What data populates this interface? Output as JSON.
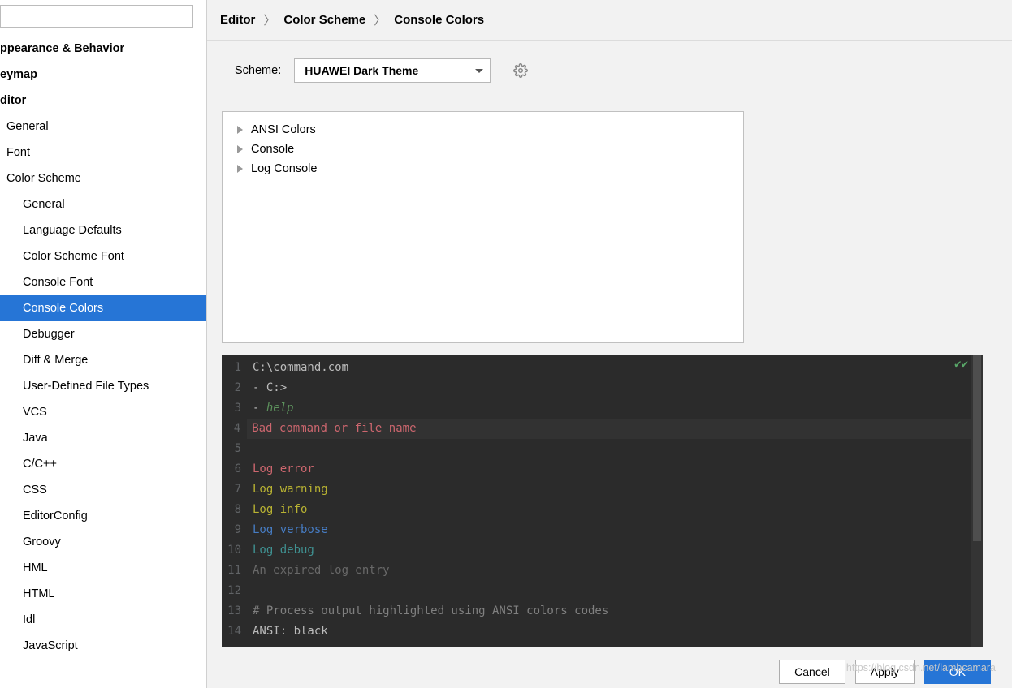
{
  "sidebar": {
    "search_placeholder": "",
    "items": [
      {
        "label": "ppearance & Behavior",
        "level": 0
      },
      {
        "label": "eymap",
        "level": 0
      },
      {
        "label": "ditor",
        "level": 0
      },
      {
        "label": "General",
        "level": 1
      },
      {
        "label": "Font",
        "level": 1
      },
      {
        "label": "Color Scheme",
        "level": 1
      },
      {
        "label": "General",
        "level": 2
      },
      {
        "label": "Language Defaults",
        "level": 2
      },
      {
        "label": "Color Scheme Font",
        "level": 2
      },
      {
        "label": "Console Font",
        "level": 2
      },
      {
        "label": "Console Colors",
        "level": 2,
        "selected": true
      },
      {
        "label": "Debugger",
        "level": 2
      },
      {
        "label": "Diff & Merge",
        "level": 2
      },
      {
        "label": "User-Defined File Types",
        "level": 2
      },
      {
        "label": "VCS",
        "level": 2
      },
      {
        "label": "Java",
        "level": 2
      },
      {
        "label": "C/C++",
        "level": 2
      },
      {
        "label": "CSS",
        "level": 2
      },
      {
        "label": "EditorConfig",
        "level": 2
      },
      {
        "label": "Groovy",
        "level": 2
      },
      {
        "label": "HML",
        "level": 2
      },
      {
        "label": "HTML",
        "level": 2
      },
      {
        "label": "Idl",
        "level": 2
      },
      {
        "label": "JavaScript",
        "level": 2
      }
    ]
  },
  "breadcrumb": [
    "Editor",
    "Color Scheme",
    "Console Colors"
  ],
  "scheme": {
    "label": "Scheme:",
    "value": "HUAWEI Dark Theme"
  },
  "options": [
    "ANSI Colors",
    "Console",
    "Log Console"
  ],
  "preview_lines": [
    {
      "n": 1,
      "text": "C:\\command.com",
      "cls": "c-white"
    },
    {
      "n": 2,
      "text": "-",
      "cls": "c-cmd",
      "tail": " C:>",
      "tailcls": "c-white"
    },
    {
      "n": 3,
      "text": "-",
      "cls": "c-cmd",
      "tail": " help",
      "tailcls": "c-green-i"
    },
    {
      "n": 4,
      "text": "Bad command or file name",
      "cls": "c-red",
      "hl": true
    },
    {
      "n": 5,
      "text": "",
      "cls": ""
    },
    {
      "n": 6,
      "text": "Log error",
      "cls": "c-red"
    },
    {
      "n": 7,
      "text": "Log warning",
      "cls": "c-yellow"
    },
    {
      "n": 8,
      "text": "Log info",
      "cls": "c-yellow"
    },
    {
      "n": 9,
      "text": "Log verbose",
      "cls": "c-blue"
    },
    {
      "n": 10,
      "text": "Log debug",
      "cls": "c-cyan"
    },
    {
      "n": 11,
      "text": "An expired log entry",
      "cls": "c-gray"
    },
    {
      "n": 12,
      "text": "",
      "cls": ""
    },
    {
      "n": 13,
      "text": "# Process output highlighted using ANSI colors codes",
      "cls": "c-comment"
    },
    {
      "n": 14,
      "text": "ANSI: black",
      "cls": "c-white"
    }
  ],
  "footer": {
    "cancel": "Cancel",
    "apply": "Apply",
    "ok": "OK"
  },
  "watermark": "https://blog.csdn.net/lambcamara"
}
